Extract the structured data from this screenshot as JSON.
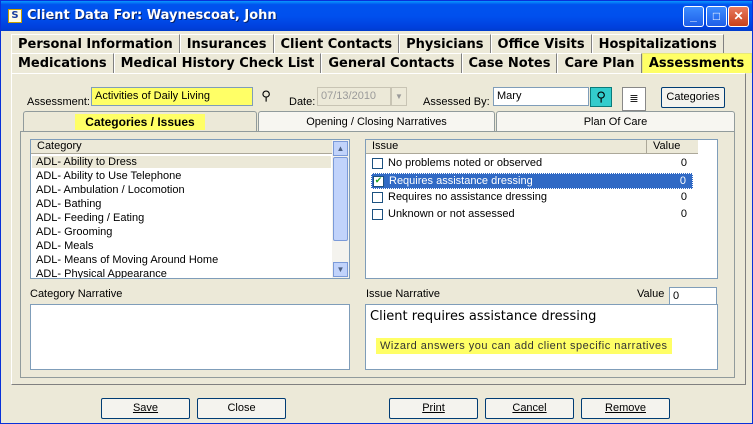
{
  "window": {
    "title": "Client Data For: Waynescoat, John",
    "icon": "document-icon"
  },
  "tabs_row1": [
    "Personal Information",
    "Insurances",
    "Client Contacts",
    "Physicians",
    "Office Visits",
    "Hospitalizations"
  ],
  "tabs_row2": [
    "Medications",
    "Medical History Check List",
    "General Contacts",
    "Case Notes",
    "Care Plan",
    "Assessments"
  ],
  "active_tab": "Assessments",
  "form": {
    "assessment_label": "Assessment:",
    "assessment_value": "Activities of Daily Living",
    "date_label": "Date:",
    "date_value": "07/13/2010",
    "assessed_by_label": "Assessed By:",
    "assessed_by_value": "Mary",
    "categories_button": "Categories"
  },
  "subtabs": [
    "Categories / Issues",
    "Opening / Closing Narratives",
    "Plan Of Care"
  ],
  "category_list": {
    "header": "Category",
    "items": [
      "ADL- Ability to Dress",
      "ADL- Ability to Use Telephone",
      "ADL- Ambulation / Locomotion",
      "ADL- Bathing",
      "ADL- Feeding / Eating",
      "ADL- Grooming",
      "ADL- Meals",
      "ADL- Means of Moving Around Home",
      "ADL- Physical Appearance"
    ],
    "selected_index": 0
  },
  "issue_list": {
    "header_issue": "Issue",
    "header_value": "Value",
    "rows": [
      {
        "label": "No problems noted or observed",
        "value": "0",
        "checked": false
      },
      {
        "label": "Requires assistance dressing",
        "value": "0",
        "checked": true
      },
      {
        "label": "Requires no assistance dressing",
        "value": "0",
        "checked": false
      },
      {
        "label": "Unknown or not assessed",
        "value": "0",
        "checked": false
      }
    ],
    "selected_index": 1
  },
  "category_narrative": {
    "label": "Category Narrative",
    "text": ""
  },
  "issue_narrative": {
    "label": "Issue Narrative",
    "value_label": "Value",
    "value": "0",
    "text": "Client requires assistance dressing",
    "note": "Wizard answers you can add client specific narratives"
  },
  "buttons": {
    "save": "Save",
    "close": "Close",
    "print": "Print",
    "cancel": "Cancel",
    "remove": "Remove"
  },
  "colors": {
    "highlight": "#ffff66",
    "titlebar": "#0053ee",
    "selection": "#316ac5",
    "face": "#ece9d8"
  }
}
